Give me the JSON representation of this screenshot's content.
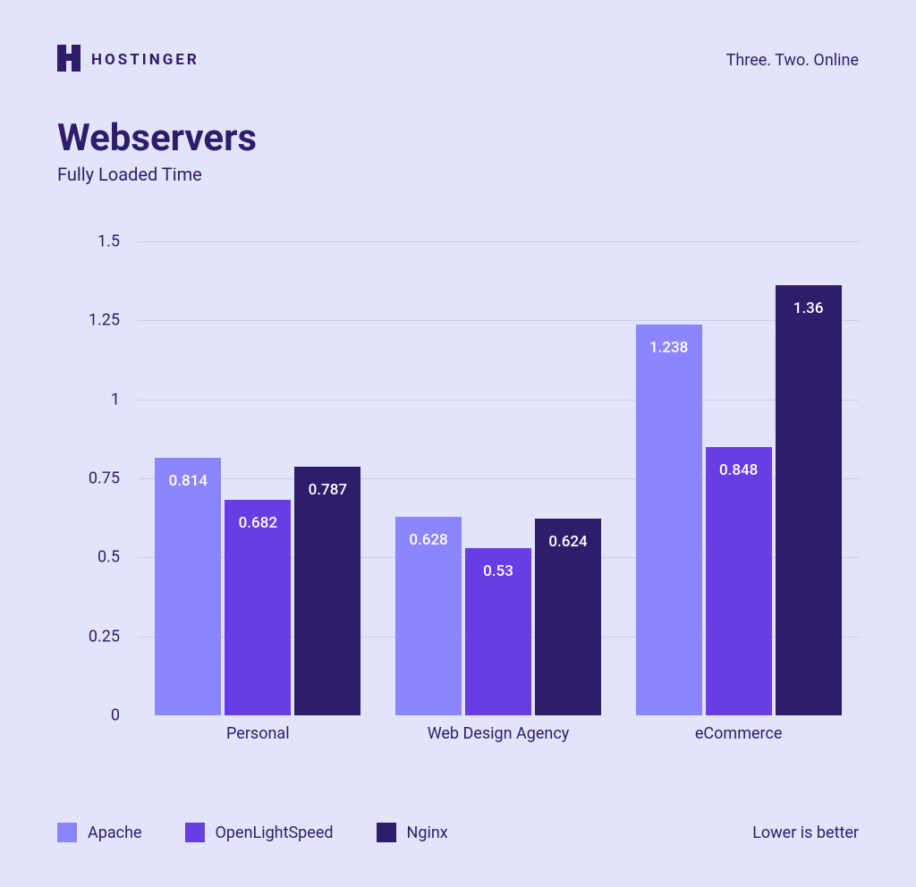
{
  "brand": {
    "name": "HOSTINGER",
    "tagline": "Three. Two. Online"
  },
  "title": "Webservers",
  "subtitle": "Fully Loaded Time",
  "note": "Lower is better",
  "colors": {
    "apache": "#8C85FF",
    "ols": "#673DE6",
    "nginx": "#2F1C6A",
    "grid": "#C7CBF0",
    "bg": "#E2E4FA"
  },
  "chart_data": {
    "type": "bar",
    "title": "Webservers — Fully Loaded Time",
    "xlabel": "",
    "ylabel": "",
    "ylim": [
      0,
      1.5
    ],
    "yticks": [
      0,
      0.25,
      0.5,
      0.75,
      1,
      1.25,
      1.5
    ],
    "categories": [
      "Personal",
      "Web Design Agency",
      "eCommerce"
    ],
    "series": [
      {
        "name": "Apache",
        "values": [
          0.814,
          0.628,
          1.238
        ],
        "color": "#8C85FF"
      },
      {
        "name": "OpenLightSpeed",
        "values": [
          0.682,
          0.53,
          0.848
        ],
        "color": "#673DE6"
      },
      {
        "name": "Nginx",
        "values": [
          0.787,
          0.624,
          1.36
        ],
        "color": "#2F1C6A"
      }
    ],
    "legend_position": "bottom",
    "grid": true
  }
}
